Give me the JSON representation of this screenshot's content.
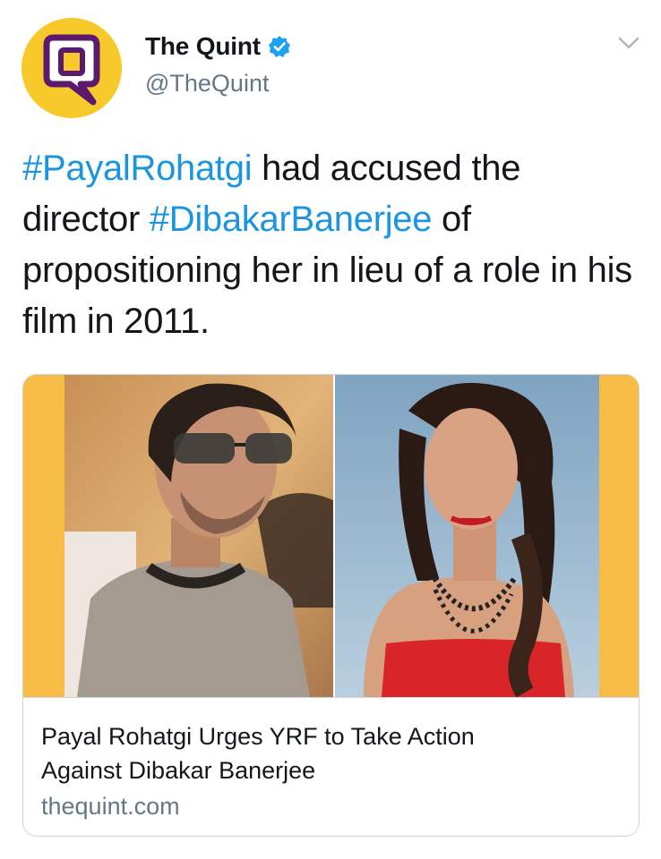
{
  "account": {
    "display_name": "The Quint",
    "handle": "@TheQuint",
    "verified": true,
    "avatar_icon": "the-quint-logo-icon",
    "brand_color": "#f8c92b"
  },
  "tweet": {
    "segments": [
      {
        "text": "#PayalRohatgi",
        "type": "hashtag"
      },
      {
        "text": " had accused the director ",
        "type": "text"
      },
      {
        "text": "#DibakarBanerjee",
        "type": "hashtag"
      },
      {
        "text": " of propositioning her in lieu of a role in his film in 2011.",
        "type": "text"
      }
    ]
  },
  "card": {
    "title": "Payal Rohatgi Urges YRF to Take Action Against Dibakar Banerjee",
    "domain": "thequint.com"
  },
  "colors": {
    "hashtag": "#1b95e0",
    "secondary_text": "#657786",
    "card_border": "#ccd6dd",
    "card_media_bg": "#f7bc46"
  }
}
